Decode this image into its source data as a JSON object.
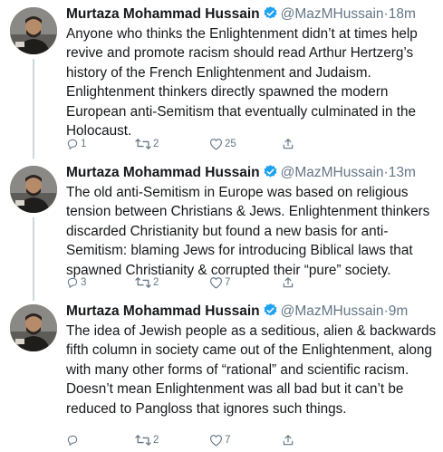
{
  "tweets": [
    {
      "name": "Murtaza Mohammad Hussain",
      "handle": "@MazMHussain",
      "dot": "·",
      "time": "18m",
      "text": "Anyone who thinks the Enlightenment didn’t at times help revive and promote racism should read Arthur Hertzerg’s history of the French Enlightenment and Judaism. Enlightenment thinkers directly spawned the modern European anti-Semitism that eventually culminated in the Holocaust.",
      "replies": "1",
      "retweets": "2",
      "likes": "25"
    },
    {
      "name": "Murtaza Mohammad Hussain",
      "handle": "@MazMHussain",
      "dot": "·",
      "time": "13m",
      "text": "The old anti-Semitism in Europe was based on religious tension between Christians & Jews. Enlightenment thinkers discarded Christianity but found a new basis for anti-Semitism: blaming Jews for introducing Biblical laws that spawned Christianity & corrupted their “pure” society.",
      "replies": "3",
      "retweets": "2",
      "likes": "7"
    },
    {
      "name": "Murtaza Mohammad Hussain",
      "handle": "@MazMHussain",
      "dot": "·",
      "time": "9m",
      "text": "The idea of Jewish people as a seditious, alien & backwards fifth column in society came out of the Enlightenment, along with many other forms of “rational” and scientific racism. Doesn’t mean Enlightenment was all bad but it can’t be reduced to Pangloss that ignores such things.",
      "replies": "",
      "retweets": "2",
      "likes": "7"
    }
  ],
  "icons": {
    "reply": "reply-icon",
    "retweet": "retweet-icon",
    "like": "like-icon",
    "share": "share-icon",
    "verified": "verified-badge-icon"
  },
  "colors": {
    "verified": "#1da1f2",
    "muted": "#657786",
    "thread_line": "#ccd6dd"
  }
}
